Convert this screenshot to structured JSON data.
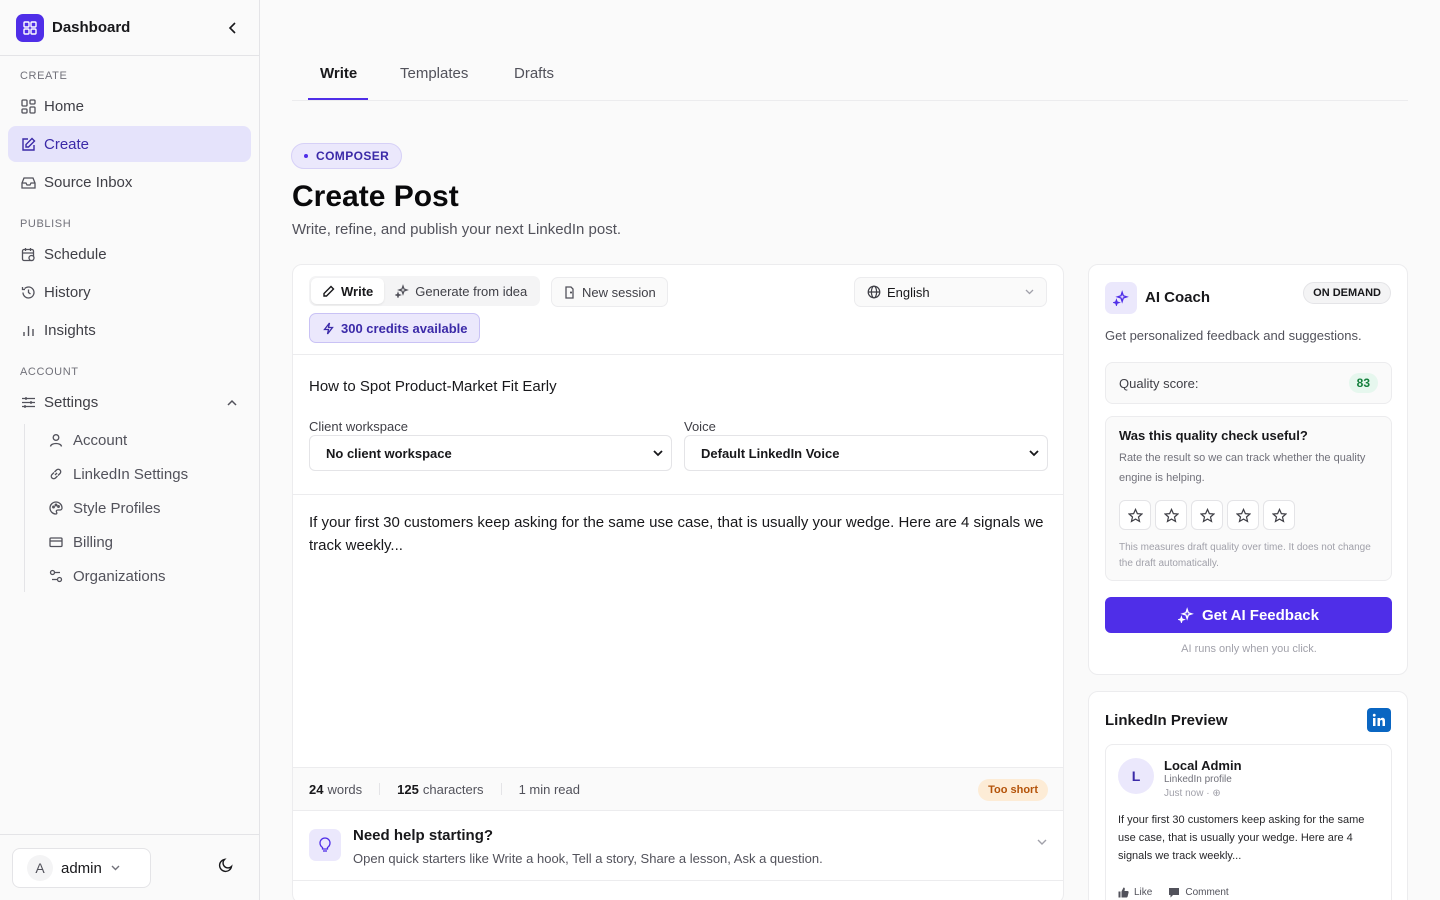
{
  "sidebar": {
    "title": "Dashboard",
    "sections": {
      "create": "CREATE",
      "publish": "PUBLISH",
      "account": "ACCOUNT"
    },
    "items": {
      "home": "Home",
      "create": "Create",
      "source_inbox": "Source Inbox",
      "schedule": "Schedule",
      "history": "History",
      "insights": "Insights",
      "settings": "Settings"
    },
    "settings_sub": {
      "account": "Account",
      "linkedin_settings": "LinkedIn Settings",
      "style_profiles": "Style Profiles",
      "billing": "Billing",
      "organizations": "Organizations"
    },
    "user": {
      "initial": "A",
      "name": "admin"
    }
  },
  "tabs": {
    "write": "Write",
    "templates": "Templates",
    "drafts": "Drafts",
    "active": "Write"
  },
  "header": {
    "badge": "COMPOSER",
    "title": "Create Post",
    "subtitle": "Write, refine, and publish your next LinkedIn post."
  },
  "editor": {
    "modes": {
      "write": "Write",
      "generate": "Generate from idea"
    },
    "new_session": "New session",
    "language": "English",
    "credits": "300 credits available",
    "post_title": "How to Spot Product-Market Fit Early",
    "client_workspace_label": "Client workspace",
    "client_workspace_value": "No client workspace",
    "voice_label": "Voice",
    "voice_value": "Default LinkedIn Voice",
    "body": "If your first 30 customers keep asking for the same use case, that is usually your wedge. Here are 4 signals we track weekly...",
    "stats": {
      "words_num": "24",
      "words_label": "words",
      "chars_num": "125",
      "chars_label": "characters",
      "read_time": "1 min read",
      "length_badge": "Too short"
    },
    "help": {
      "title": "Need help starting?",
      "subtitle": "Open quick starters like Write a hook, Tell a story, Share a lesson, Ask a question."
    }
  },
  "coach": {
    "title": "AI Coach",
    "badge": "ON DEMAND",
    "subtitle": "Get personalized feedback and suggestions.",
    "quality_label": "Quality score:",
    "quality_score": "83",
    "rate_title": "Was this quality check useful?",
    "rate_subtitle": "Rate the result so we can track whether the quality engine is helping.",
    "rating": 0,
    "rate_note": "This measures draft quality over time. It does not change the draft automatically.",
    "button": "Get AI Feedback",
    "note": "AI runs only when you click."
  },
  "preview": {
    "title": "LinkedIn Preview",
    "author_initial": "L",
    "author": "Local Admin",
    "author_meta": "LinkedIn profile",
    "time": "Just now · ⊕",
    "text": "If your first 30 customers keep asking for the same use case, that is usually your wedge. Here are 4 signals we track weekly...",
    "like": "Like",
    "comment": "Comment"
  },
  "colors": {
    "accent": "#4f2ee8",
    "accent_soft": "#ebe8fc",
    "linkedin": "#0a66c2",
    "success": "#15803d",
    "warning": "#b45309"
  }
}
